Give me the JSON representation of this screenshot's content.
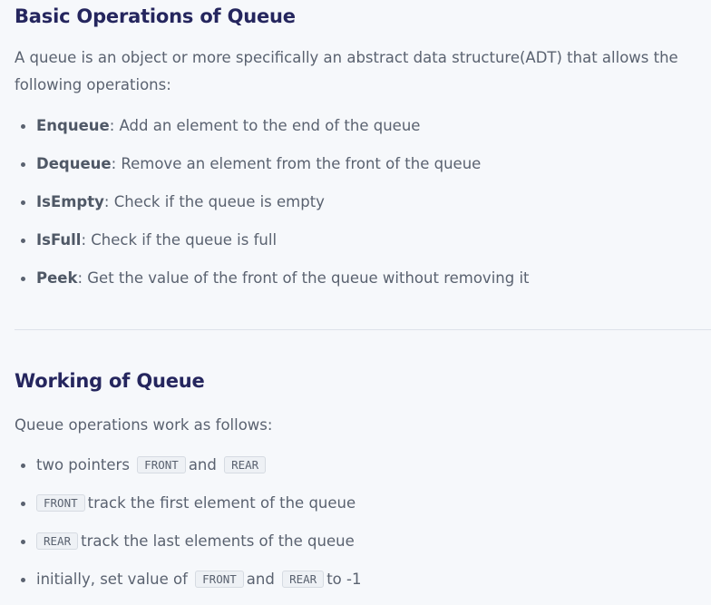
{
  "basic": {
    "heading": "Basic Operations of Queue",
    "intro": "A queue is an object or more specifically an abstract data structure(ADT) that allows the following operations:",
    "items": [
      {
        "term": "Enqueue",
        "desc": ": Add an element to the end of the queue"
      },
      {
        "term": "Dequeue",
        "desc": ": Remove an element from the front of the queue"
      },
      {
        "term": "IsEmpty",
        "desc": ": Check if the queue is empty"
      },
      {
        "term": "IsFull",
        "desc": ": Check if the queue is full"
      },
      {
        "term": "Peek",
        "desc": ": Get the value of the front of the queue without removing it"
      }
    ]
  },
  "working": {
    "heading": "Working of Queue",
    "intro": "Queue operations work as follows:",
    "item1": {
      "text_a": "two pointers",
      "code_a": "FRONT",
      "text_b": "and",
      "code_b": "REAR"
    },
    "item2": {
      "code_a": "FRONT",
      "text_a": "track the first element of the queue"
    },
    "item3": {
      "code_a": "REAR",
      "text_a": "track the last elements of the queue"
    },
    "item4": {
      "text_a": "initially, set value of",
      "code_a": "FRONT",
      "text_b": "and",
      "code_b": "REAR",
      "text_c": "to -1"
    }
  }
}
